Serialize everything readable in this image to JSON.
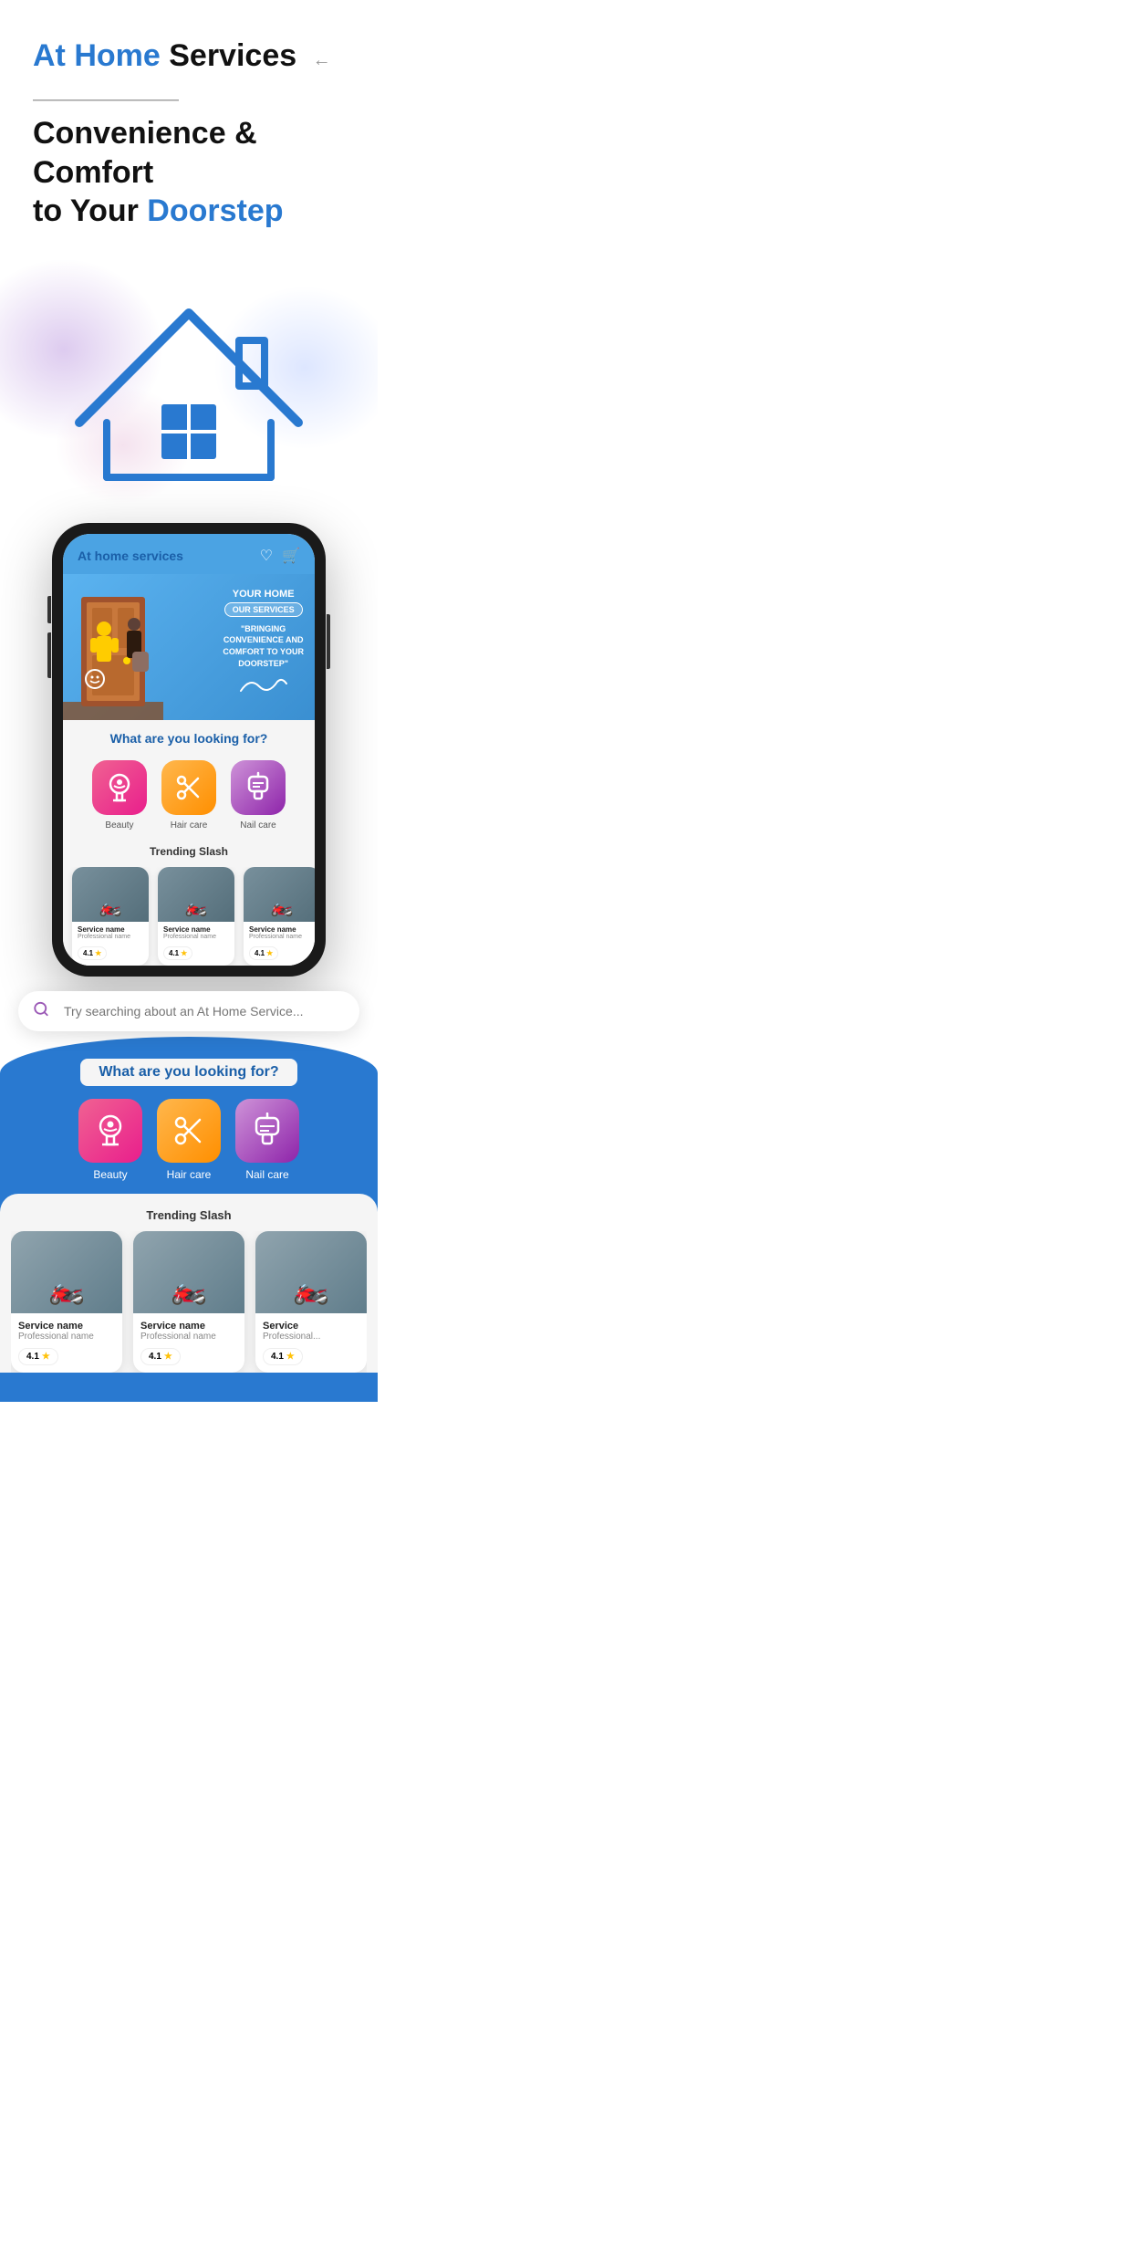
{
  "hero": {
    "title_blue1": "At Home",
    "title_black1": " Services",
    "title_black2": "Convenience & Comfort",
    "title_black3": "to Your ",
    "title_blue2": "Doorstep"
  },
  "search": {
    "placeholder": "Try searching about an At Home Service..."
  },
  "app": {
    "title": "At home services",
    "looking_for": "What are you looking for?",
    "trending_label": "Trending Slash",
    "banner": {
      "your_home": "YOUR HOME",
      "our_services": "OUR SERVICES",
      "tagline": "\"BRINGING CONVENIENCE AND COMFORT TO YOUR DOORSTEP\""
    },
    "categories": [
      {
        "label": "Beauty",
        "emoji": "💄",
        "color_class": "cat-beauty"
      },
      {
        "label": "Hair care",
        "emoji": "✂️",
        "color_class": "cat-hair"
      },
      {
        "label": "Nail care",
        "emoji": "💅",
        "color_class": "cat-nail"
      }
    ],
    "service_cards": [
      {
        "name": "Service name",
        "professional": "Professional name",
        "rating": "4.1"
      },
      {
        "name": "Service name",
        "professional": "Professional name",
        "rating": "4.1"
      },
      {
        "name": "Service name",
        "professional": "Professional name",
        "rating": "4.1"
      }
    ]
  },
  "bottom_cards": [
    {
      "name": "Service name",
      "professional": "Professional name",
      "rating": "4.1"
    },
    {
      "name": "Service name",
      "professional": "Professional name",
      "rating": "4.1"
    },
    {
      "name": "Service",
      "professional": "Professional...",
      "rating": "4.1"
    }
  ],
  "icons": {
    "arrow": "←",
    "search": "🔍",
    "heart": "♡",
    "cart": "🛒",
    "star": "★"
  }
}
